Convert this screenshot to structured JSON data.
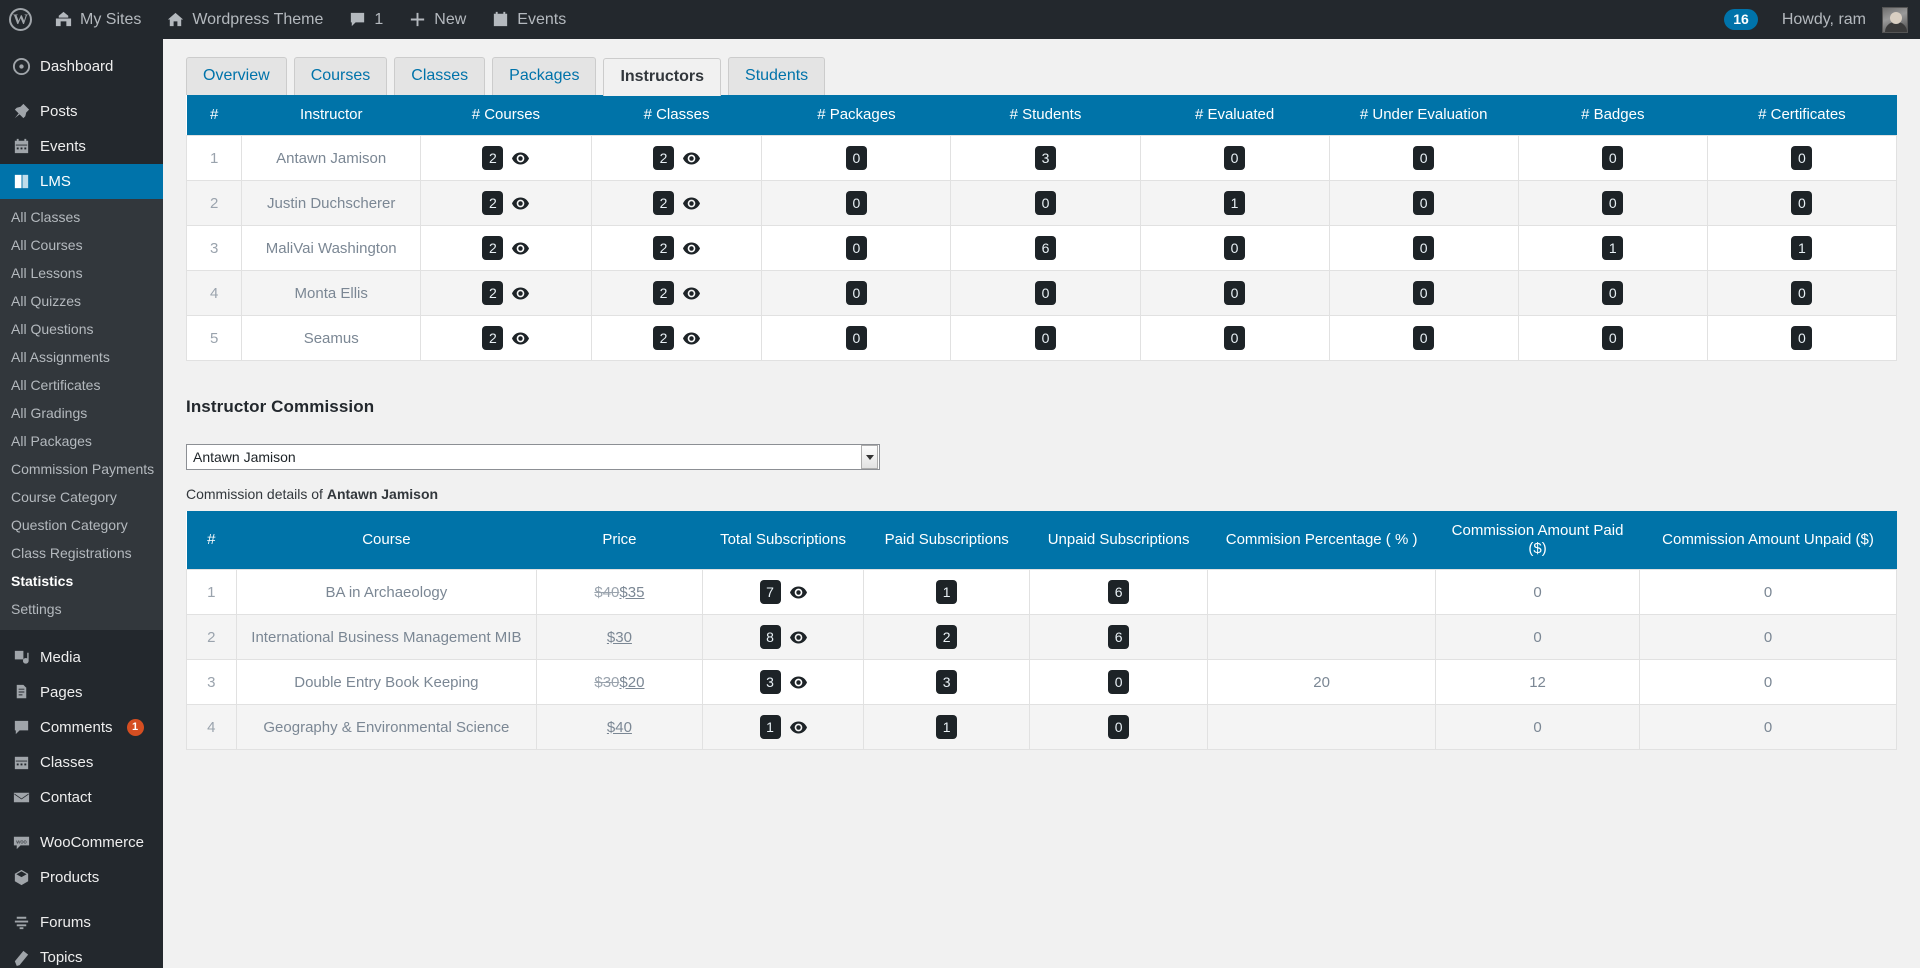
{
  "adminbar": {
    "logo_icon": "wordpress-logo-icon",
    "items": [
      {
        "label": "My Sites",
        "icon": "sites-icon"
      },
      {
        "label": "Wordpress Theme",
        "icon": "home-icon"
      },
      {
        "label": "1",
        "icon": "comment-icon"
      },
      {
        "label": "New",
        "icon": "plus-icon"
      },
      {
        "label": "Events",
        "icon": "calendar-icon"
      }
    ],
    "notification_count": "16",
    "howdy": "Howdy, ram"
  },
  "sidebar": {
    "top_items": [
      {
        "label": "Dashboard",
        "icon": "dashboard-icon",
        "current": false
      },
      {
        "label": "Posts",
        "icon": "pin-icon",
        "current": false
      },
      {
        "label": "Events",
        "icon": "calendar-icon",
        "current": false
      },
      {
        "label": "LMS",
        "icon": "book-icon",
        "current": true
      }
    ],
    "lms_submenu": [
      {
        "label": "All Classes",
        "current": false
      },
      {
        "label": "All Courses",
        "current": false
      },
      {
        "label": "All Lessons",
        "current": false
      },
      {
        "label": "All Quizzes",
        "current": false
      },
      {
        "label": "All Questions",
        "current": false
      },
      {
        "label": "All Assignments",
        "current": false
      },
      {
        "label": "All Certificates",
        "current": false
      },
      {
        "label": "All Gradings",
        "current": false
      },
      {
        "label": "All Packages",
        "current": false
      },
      {
        "label": "Commission Payments",
        "current": false
      },
      {
        "label": "Course Category",
        "current": false
      },
      {
        "label": "Question Category",
        "current": false
      },
      {
        "label": "Class Registrations",
        "current": false
      },
      {
        "label": "Statistics",
        "current": true
      },
      {
        "label": "Settings",
        "current": false
      }
    ],
    "lower_items": [
      {
        "label": "Media",
        "icon": "media-icon",
        "badge": ""
      },
      {
        "label": "Pages",
        "icon": "pages-icon",
        "badge": ""
      },
      {
        "label": "Comments",
        "icon": "comments-icon",
        "badge": "1"
      },
      {
        "label": "Classes",
        "icon": "calendar-icon",
        "badge": ""
      },
      {
        "label": "Contact",
        "icon": "envelope-icon",
        "badge": ""
      }
    ],
    "commerce_items": [
      {
        "label": "WooCommerce",
        "icon": "woocommerce-icon"
      },
      {
        "label": "Products",
        "icon": "products-icon"
      }
    ],
    "forum_items": [
      {
        "label": "Forums",
        "icon": "forums-icon"
      },
      {
        "label": "Topics",
        "icon": "topics-icon"
      }
    ]
  },
  "tabs": [
    {
      "label": "Overview",
      "active": false
    },
    {
      "label": "Courses",
      "active": false
    },
    {
      "label": "Classes",
      "active": false
    },
    {
      "label": "Packages",
      "active": false
    },
    {
      "label": "Instructors",
      "active": true
    },
    {
      "label": "Students",
      "active": false
    }
  ],
  "instructors_table": {
    "columns": [
      "#",
      "Instructor",
      "# Courses",
      "# Classes",
      "# Packages",
      "# Students",
      "# Evaluated",
      "# Under Evaluation",
      "# Badges",
      "# Certificates"
    ],
    "rows": [
      {
        "num": "1",
        "instructor": "Antawn Jamison",
        "courses": "2",
        "classes": "2",
        "packages": "0",
        "students": "3",
        "evaluated": "0",
        "under_evaluation": "0",
        "badges": "0",
        "certificates": "0"
      },
      {
        "num": "2",
        "instructor": "Justin Duchscherer",
        "courses": "2",
        "classes": "2",
        "packages": "0",
        "students": "0",
        "evaluated": "1",
        "under_evaluation": "0",
        "badges": "0",
        "certificates": "0"
      },
      {
        "num": "3",
        "instructor": "MaliVai Washington",
        "courses": "2",
        "classes": "2",
        "packages": "0",
        "students": "6",
        "evaluated": "0",
        "under_evaluation": "0",
        "badges": "1",
        "certificates": "1"
      },
      {
        "num": "4",
        "instructor": "Monta Ellis",
        "courses": "2",
        "classes": "2",
        "packages": "0",
        "students": "0",
        "evaluated": "0",
        "under_evaluation": "0",
        "badges": "0",
        "certificates": "0"
      },
      {
        "num": "5",
        "instructor": "Seamus",
        "courses": "2",
        "classes": "2",
        "packages": "0",
        "students": "0",
        "evaluated": "0",
        "under_evaluation": "0",
        "badges": "0",
        "certificates": "0"
      }
    ]
  },
  "commission": {
    "section_title": "Instructor Commission",
    "selected_instructor": "Antawn Jamison",
    "instructor_options": [
      "Antawn Jamison",
      "Justin Duchscherer",
      "MaliVai Washington",
      "Monta Ellis",
      "Seamus"
    ],
    "caption_prefix": "Commission details of ",
    "caption_name": "Antawn Jamison",
    "columns": [
      "#",
      "Course",
      "Price",
      "Total Subscriptions",
      "Paid Subscriptions",
      "Unpaid Subscriptions",
      "Commision Percentage ( % )",
      "Commission Amount Paid ($)",
      "Commission Amount Unpaid ($)"
    ],
    "rows": [
      {
        "num": "1",
        "course": "BA in Archaeology",
        "price_old": "$40",
        "price_new": "$35",
        "total": "7",
        "paid": "1",
        "unpaid": "6",
        "percentage": "",
        "amount_paid": "0",
        "amount_unpaid": "0"
      },
      {
        "num": "2",
        "course": "International Business Management MIB",
        "price_old": "",
        "price_new": "$30",
        "total": "8",
        "paid": "2",
        "unpaid": "6",
        "percentage": "",
        "amount_paid": "0",
        "amount_unpaid": "0"
      },
      {
        "num": "3",
        "course": "Double Entry Book Keeping",
        "price_old": "$30",
        "price_new": "$20",
        "total": "3",
        "paid": "3",
        "unpaid": "0",
        "percentage": "20",
        "amount_paid": "12",
        "amount_unpaid": "0"
      },
      {
        "num": "4",
        "course": "Geography & Environmental Science",
        "price_old": "",
        "price_new": "$40",
        "total": "1",
        "paid": "1",
        "unpaid": "0",
        "percentage": "",
        "amount_paid": "0",
        "amount_unpaid": "0"
      }
    ]
  },
  "colors": {
    "admin_dark": "#23282d",
    "accent_blue": "#0073aa",
    "table_header": "#0073a8",
    "badge_dark": "#1d2327"
  }
}
